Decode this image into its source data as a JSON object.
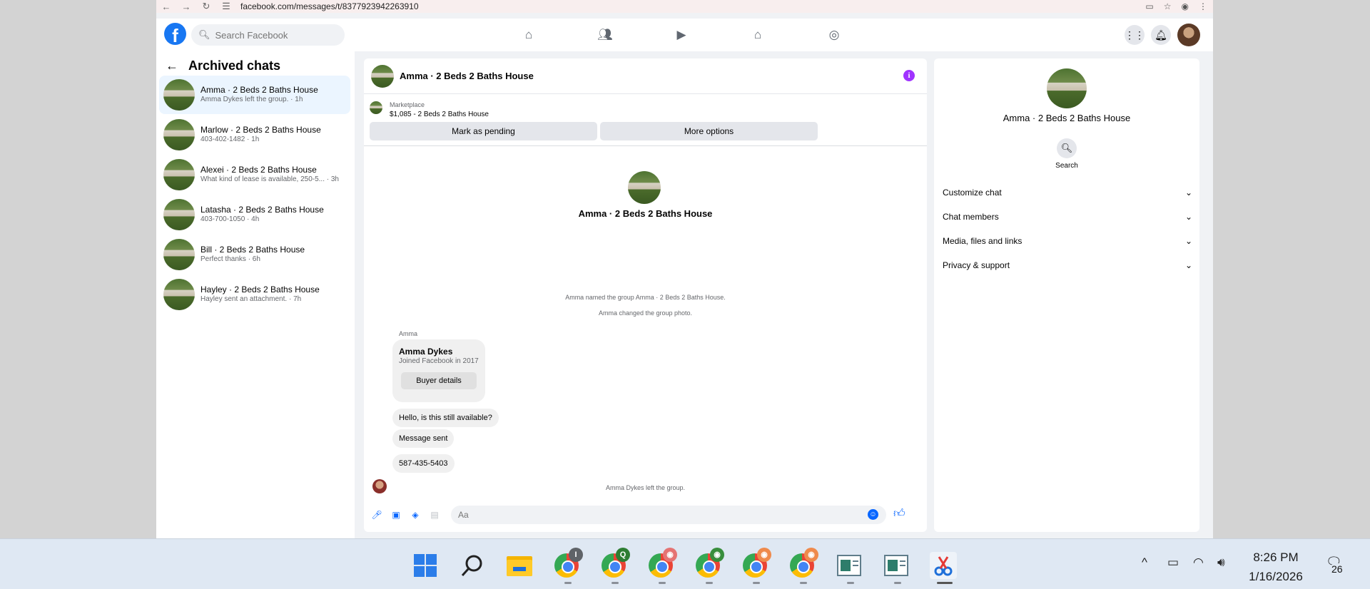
{
  "browser": {
    "url": "facebook.com/messages/t/8377923942263910"
  },
  "fb": {
    "logo": "f",
    "search_placeholder": "Search Facebook",
    "nav_icons": [
      "home-icon",
      "friends-icon",
      "video-icon",
      "marketplace-icon",
      "groups-icon"
    ],
    "right_icons": [
      "menu-grid-icon",
      "bell-icon"
    ]
  },
  "sidebar": {
    "title": "Archived chats",
    "chats": [
      {
        "name": "Amma · 2 Beds 2 Baths House",
        "sub": "Amma Dykes left the group. · 1h",
        "active": true
      },
      {
        "name": "Marlow · 2 Beds 2 Baths House",
        "sub": "403-402-1482 · 1h"
      },
      {
        "name": "Alexei · 2 Beds 2 Baths House",
        "sub": "What kind of lease is available, 250-5... · 3h"
      },
      {
        "name": "Latasha · 2 Beds 2 Baths House",
        "sub": "403-700-1050 · 4h"
      },
      {
        "name": "Bill · 2 Beds 2 Baths House",
        "sub": "Perfect thanks · 6h"
      },
      {
        "name": "Hayley · 2 Beds 2 Baths House",
        "sub": "Hayley sent an attachment. · 7h"
      }
    ]
  },
  "conversation": {
    "title": "Amma · 2 Beds 2 Baths House",
    "marketplace_label": "Marketplace",
    "listing": "$1,085 - 2 Beds 2 Baths House",
    "mark_pending": "Mark as pending",
    "more_options": "More options",
    "group_name": "Amma · 2 Beds 2 Baths House",
    "sys1": "Amma named the group Amma · 2 Beds 2 Baths House.",
    "sys2": "Amma changed the group photo.",
    "sender": "Amma",
    "card_name": "Amma Dykes",
    "card_sub": "Joined Facebook in 2017",
    "card_button": "Buyer details",
    "msg1": "Hello, is this still available?",
    "msg2": "Message sent",
    "msg3": "587-435-5403",
    "sys3": "Amma Dykes left the group.",
    "input_placeholder": "Aa"
  },
  "info": {
    "name": "Amma · 2 Beds 2 Baths House",
    "search_label": "Search",
    "sections": [
      "Customize chat",
      "Chat members",
      "Media, files and links",
      "Privacy & support"
    ]
  },
  "taskbar": {
    "time": "8:26 PM",
    "date": "1/16/2026",
    "notification_count": "26",
    "badges": [
      "I",
      "Q"
    ]
  },
  "colors": {
    "fb_blue": "#1877f2",
    "messenger_blue": "#0866ff",
    "info_purple": "#a033ff",
    "active_chat_bg": "#ebf5ff"
  }
}
